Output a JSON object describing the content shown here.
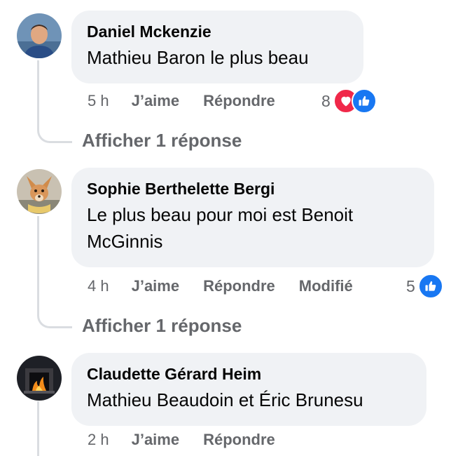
{
  "comments": [
    {
      "author": "Daniel Mckenzie",
      "text": "Mathieu Baron le plus beau",
      "time": "5 h",
      "like_label": "J’aime",
      "reply_label": "Répondre",
      "edited_label": "",
      "reaction_count": "8",
      "reactions": [
        "heart-icon",
        "like-icon"
      ],
      "show_replies": "Afficher 1 réponse"
    },
    {
      "author": "Sophie Berthelette Bergi",
      "text": "Le plus beau pour moi est Benoit McGinnis",
      "time": "4 h",
      "like_label": "J’aime",
      "reply_label": "Répondre",
      "edited_label": "Modifié",
      "reaction_count": "5",
      "reactions": [
        "like-icon"
      ],
      "show_replies": "Afficher 1 réponse"
    },
    {
      "author": "Claudette Gérard Heim",
      "text": "Mathieu Beaudoin et Éric Brunesu",
      "time": "2 h",
      "like_label": "J’aime",
      "reply_label": "Répondre",
      "edited_label": "",
      "reaction_count": "",
      "reactions": [],
      "show_replies": ""
    }
  ],
  "colors": {
    "bubble": "#f0f2f5",
    "meta_text": "#65676b",
    "like_blue": "#1877f2",
    "love_red": "#f02849",
    "thread_line": "#dadde1"
  }
}
